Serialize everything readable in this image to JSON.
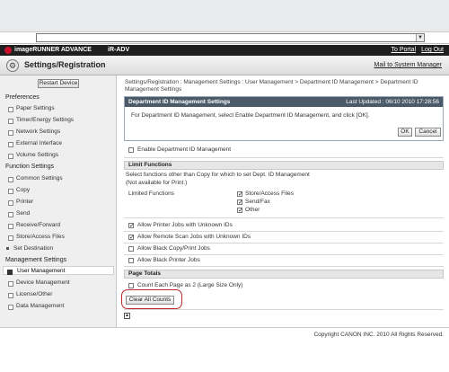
{
  "browser": {
    "address_value": "",
    "dropdown_icon": "chevron-down-icon"
  },
  "brand": {
    "product": "imageRUNNER ADVANCE",
    "model": "iR-ADV",
    "portal_link": "To Portal",
    "logout_link": "Log Out",
    "accent_color": "#c8102e"
  },
  "header": {
    "title": "Settings/Registration",
    "mail_link": "Mail to System Manager"
  },
  "sidebar": {
    "restart_label": "Restart Device",
    "preferences_head": "Preferences",
    "preferences": [
      "Paper Settings",
      "Timer/Energy Settings",
      "Network Settings",
      "External Interface",
      "Volume Settings"
    ],
    "function_head": "Function Settings",
    "functions": [
      "Common Settings",
      "Copy",
      "Printer",
      "Send",
      "Receive/Forward",
      "Store/Access Files"
    ],
    "set_destination": "Set Destination",
    "management_head": "Management Settings",
    "management": [
      "User Management",
      "Device Management",
      "License/Other",
      "Data Management"
    ],
    "active_item": "User Management"
  },
  "main": {
    "breadcrumb": "Settings/Registration : Management Settings : User Management > Department ID Management > Department ID Management Settings",
    "panel": {
      "title": "Department ID Management Settings",
      "last_updated": "Last Updated : 06/10 2010 17:28:56",
      "message": "For Department ID Management, select Enable Department ID Management, and click [OK].",
      "ok_label": "OK",
      "cancel_label": "Cancel"
    },
    "enable_label": "Enable Department ID Management",
    "limit_functions": {
      "head": "Limit Functions",
      "note1": "Select functions other than Copy for which to set Dept. ID Management",
      "note2": "(Not available for Print.)",
      "label": "Limited Functions",
      "options": [
        "Store/Access Files",
        "Send/Fax",
        "Other"
      ]
    },
    "jobs": [
      "Allow Printer Jobs with Unknown IDs",
      "Allow Remote Scan Jobs with Unknown IDs",
      "Allow Black Copy/Print Jobs",
      "Allow Black Printer Jobs"
    ],
    "page_totals": {
      "head": "Page Totals",
      "count_label": "Count Each Page as 2 (Large Size Only)",
      "clear_label": "Clear All Counts"
    }
  },
  "footer": {
    "copyright": "Copyright CANON INC. 2010 All Rights Reserved."
  }
}
